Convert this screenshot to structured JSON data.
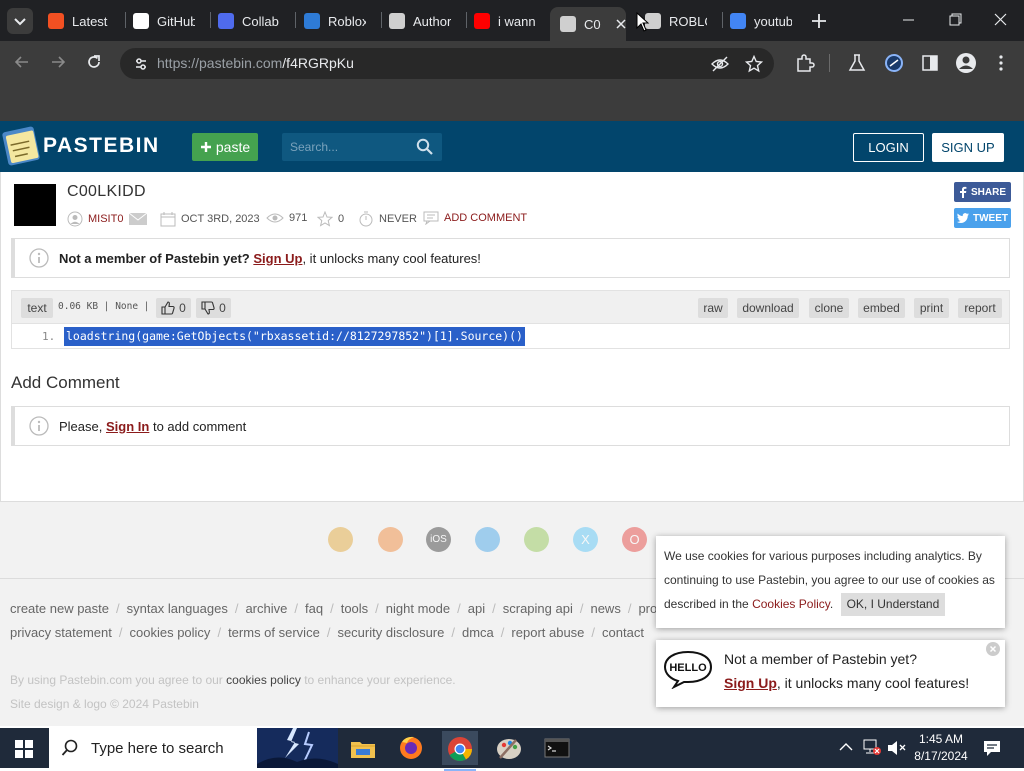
{
  "browser": {
    "tabs": [
      {
        "label": "Latest",
        "icon": "windows-logo-icon",
        "color": "#f25022"
      },
      {
        "label": "GitHub",
        "icon": "github-icon",
        "color": "#ffffff"
      },
      {
        "label": "Collab",
        "icon": "search-icon",
        "color": "#4f6bed"
      },
      {
        "label": "Roblox",
        "icon": "roblox-icon",
        "color": "#2e7bd6"
      },
      {
        "label": "Author",
        "icon": "roblox-studio-icon",
        "color": "#cfcfcf"
      },
      {
        "label": "i wann",
        "icon": "youtube-icon",
        "color": "#ff0000"
      },
      {
        "label": "C0",
        "icon": "pastebin-icon",
        "color": "#cfcfcf"
      },
      {
        "label": "ROBLO",
        "icon": "roblox-studio-icon",
        "color": "#cfcfcf"
      },
      {
        "label": "youtub",
        "icon": "google-icon",
        "color": "#4285f4"
      }
    ],
    "url_host": "https://pastebin.com",
    "url_path": "/f4RGRpKu"
  },
  "header": {
    "logo": "PASTEBIN",
    "paste_label": "paste",
    "search_placeholder": "Search...",
    "login_label": "LOGIN",
    "signup_label": "SIGN UP"
  },
  "paste": {
    "title": "C00LKIDD",
    "author": "MISIT0",
    "date": "OCT 3RD, 2023",
    "views": "971",
    "stars": "0",
    "expiry": "NEVER",
    "add_comment_link": "ADD COMMENT",
    "share_label": "SHARE",
    "tweet_label": "TWEET",
    "syntax": "text",
    "size_info": "0.06 KB | None |",
    "likes": "0",
    "dislikes": "0",
    "actions": [
      "raw",
      "download",
      "clone",
      "embed",
      "print",
      "report"
    ],
    "line_number": "1.",
    "code": "loadstring(game:GetObjects(\"rbxassetid://8127297852\")[1].Source)()"
  },
  "notice_member": {
    "bold": "Not a member of Pastebin yet?",
    "link": "Sign Up",
    "rest": ", it unlocks many cool features!"
  },
  "comments": {
    "heading": "Add Comment",
    "pre": "Please, ",
    "link": "Sign In",
    "post": " to add comment"
  },
  "footer": {
    "links_row1": [
      "create new paste",
      "syntax languages",
      "archive",
      "faq",
      "tools",
      "night mode",
      "api",
      "scraping api",
      "news",
      "pro"
    ],
    "links_row2": [
      "privacy statement",
      "cookies policy",
      "terms of service",
      "security disclosure",
      "dmca",
      "report abuse",
      "contact"
    ],
    "cookie_line_pre": "By using Pastebin.com you agree to our",
    "cookie_line_link": "cookies policy",
    "cookie_line_post": "to enhance your experience.",
    "copyright": "Site design & logo © 2024 Pastebin",
    "app_icons": [
      "chrome-icon",
      "firefox-icon",
      "ios-icon",
      "windows-icon",
      "android-icon",
      "x-icon",
      "opera-icon"
    ]
  },
  "cookie_popup": {
    "text": "We use cookies for various purposes including analytics. By continuing to use Pastebin, you agree to our use of cookies as described in the",
    "link": "Cookies Policy",
    "button": "OK, I Understand"
  },
  "member_popup": {
    "line1": "Not a member of Pastebin yet?",
    "link": "Sign Up",
    "line2_rest": ", it unlocks many cool features!"
  },
  "taskbar": {
    "search_placeholder": "Type here to search",
    "time": "1:45 AM",
    "date": "8/17/2024"
  }
}
